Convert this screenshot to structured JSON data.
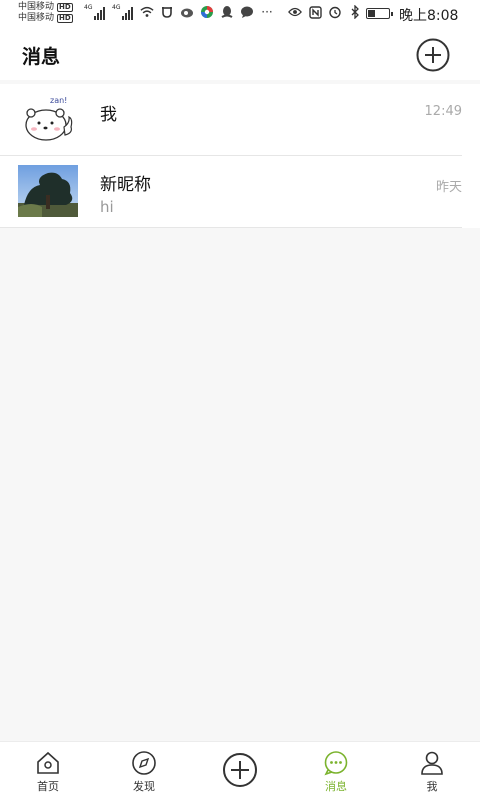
{
  "status_bar": {
    "carrier_1": "中国移动",
    "carrier_2": "中国移动",
    "hd_badge": "HD",
    "network_1": "4G",
    "network_2": "4G",
    "time": "晚上8:08",
    "more_label": "···"
  },
  "header": {
    "title": "消息",
    "add_icon": "plus-circle-icon"
  },
  "conversations": [
    {
      "name": "我",
      "preview": "",
      "time": "12:49",
      "avatar": "bear-zan-sticker"
    },
    {
      "name": "新昵称",
      "preview": "hi",
      "time": "昨天",
      "avatar": "tree-photo"
    }
  ],
  "tabbar": {
    "items": [
      {
        "label": "首页",
        "icon": "home-icon",
        "active": false
      },
      {
        "label": "发现",
        "icon": "compass-icon",
        "active": false
      },
      {
        "label": "",
        "icon": "add-circle-icon",
        "active": false
      },
      {
        "label": "消息",
        "icon": "chat-icon",
        "active": true
      },
      {
        "label": "我",
        "icon": "user-icon",
        "active": false
      }
    ],
    "accent_color": "#7bb32e"
  },
  "avatar_sticker_text": "zan!"
}
